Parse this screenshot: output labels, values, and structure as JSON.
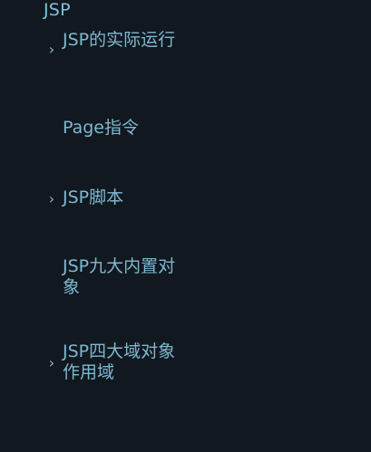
{
  "theme": {
    "background": "#111820",
    "accent": "#7fc1d8",
    "item_text": "#7fb8cf",
    "chevron": "#9bb3c2"
  },
  "section": {
    "title": "JSP",
    "caret_icon": "chevron-down-icon"
  },
  "nav": {
    "items": [
      {
        "label": "JSP的实际运行",
        "icon": "chevron-right-icon",
        "has_children": true
      },
      {
        "label": "Page指令",
        "has_children": false
      },
      {
        "label": "JSP脚本",
        "icon": "chevron-right-icon",
        "has_children": true
      },
      {
        "label": "JSP九大内置对象",
        "has_children": false
      },
      {
        "label": "JSP四大域对象作用域",
        "icon": "chevron-right-icon",
        "has_children": true
      }
    ]
  }
}
